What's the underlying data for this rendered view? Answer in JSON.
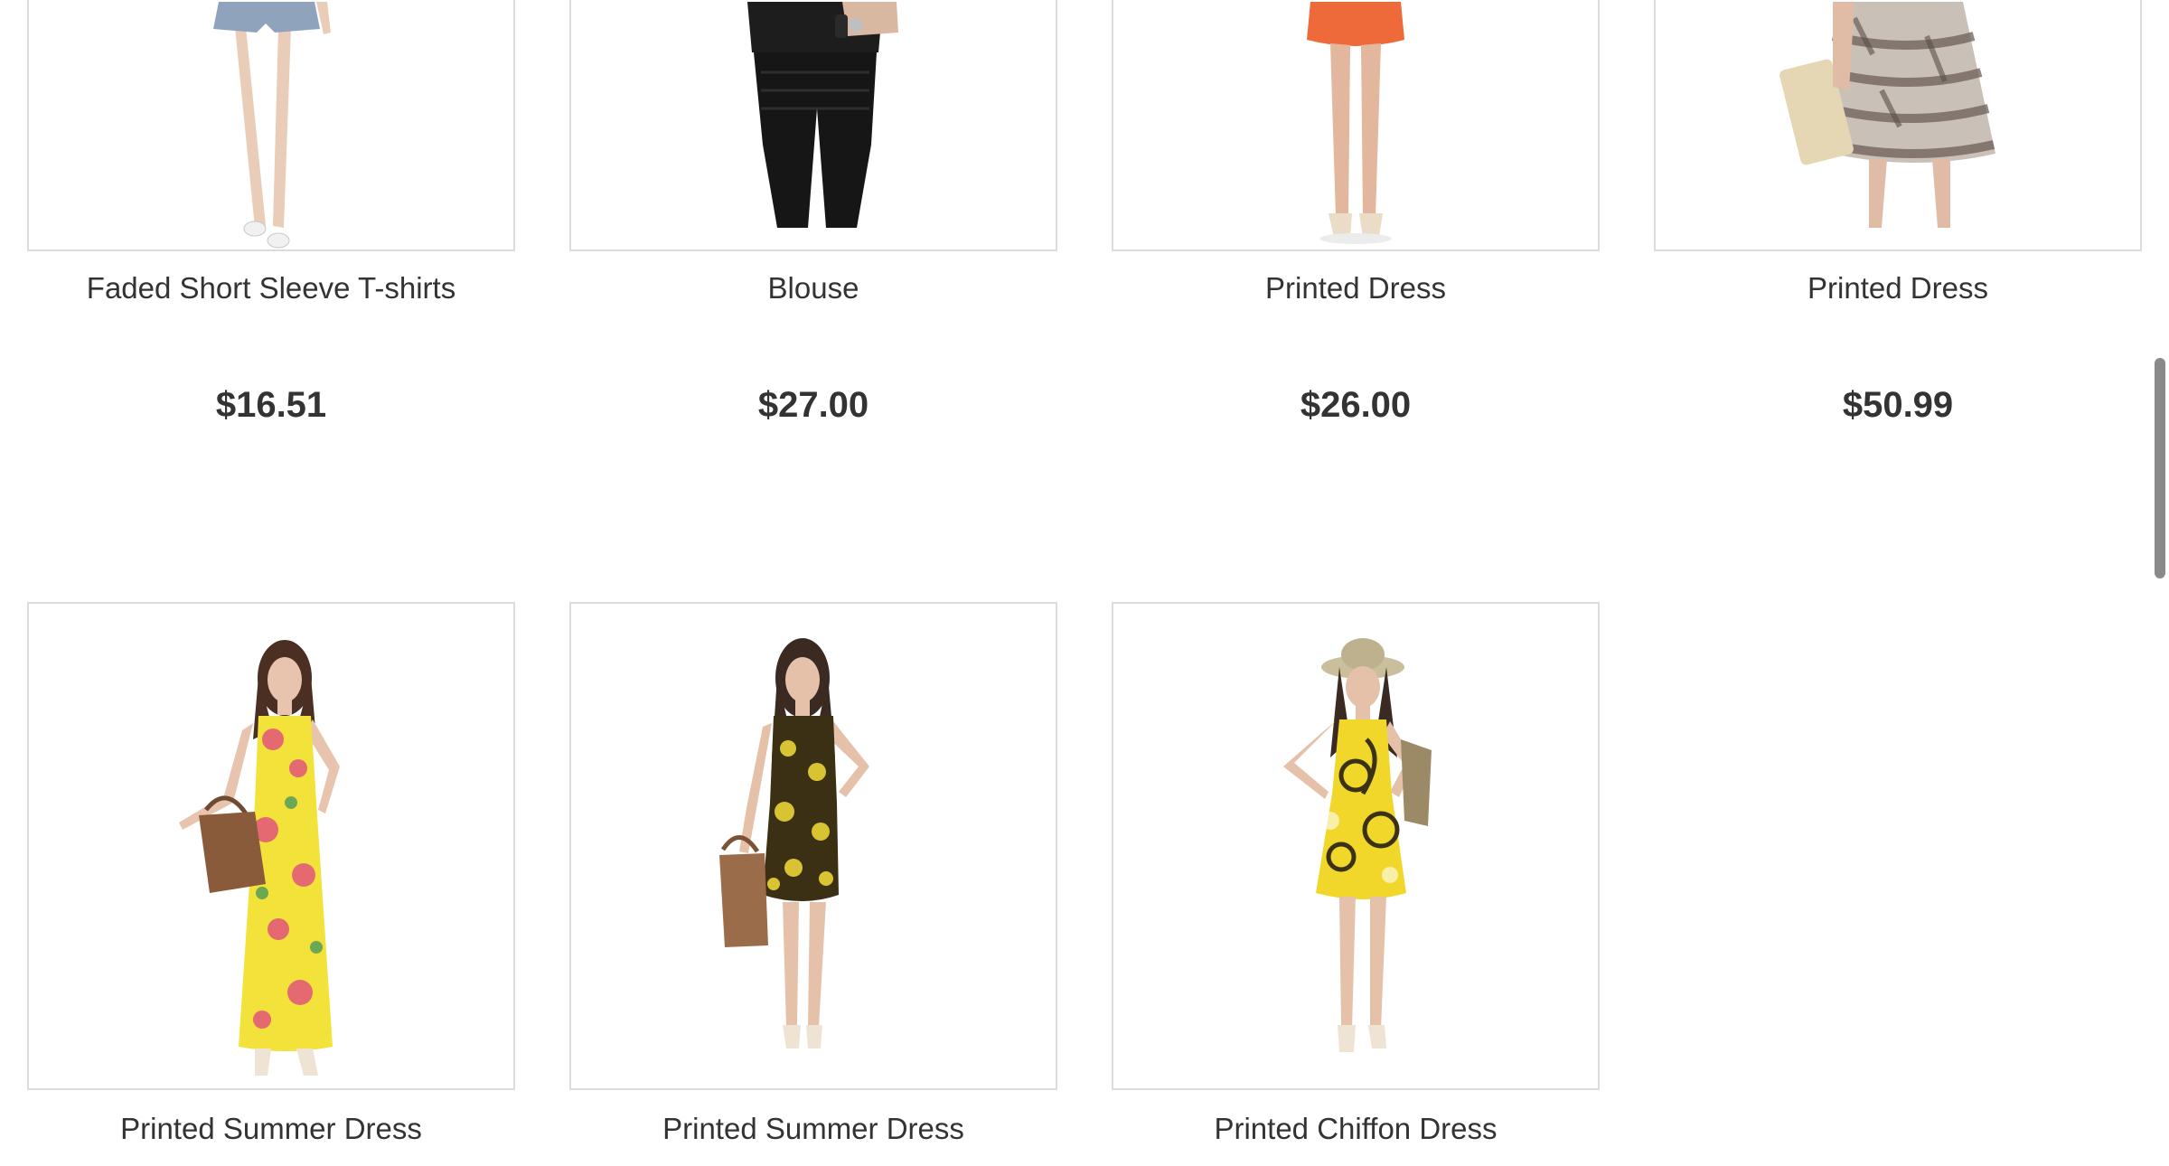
{
  "products_row_1": [
    {
      "name": "Faded Short Sleeve T-shirts",
      "price": "$16.51",
      "image": "denim-shorts-model-photo"
    },
    {
      "name": "Blouse",
      "price": "$27.00",
      "image": "black-blouse-model-photo"
    },
    {
      "name": "Printed Dress",
      "price": "$26.00",
      "image": "orange-dress-model-photo"
    },
    {
      "name": "Printed Dress",
      "price": "$50.99",
      "image": "printed-ruffle-dress-model-photo"
    }
  ],
  "products_row_2": [
    {
      "name": "Printed Summer Dress",
      "image": "yellow-floral-maxi-dress-model-photo"
    },
    {
      "name": "Printed Summer Dress",
      "image": "black-yellow-summer-dress-model-photo"
    },
    {
      "name": "Printed Chiffon Dress",
      "image": "yellow-chiffon-dress-model-photo"
    }
  ],
  "colors": {
    "text": "#333333",
    "border": "#dcdcdc",
    "scrollbar": "#8a8a8a"
  }
}
